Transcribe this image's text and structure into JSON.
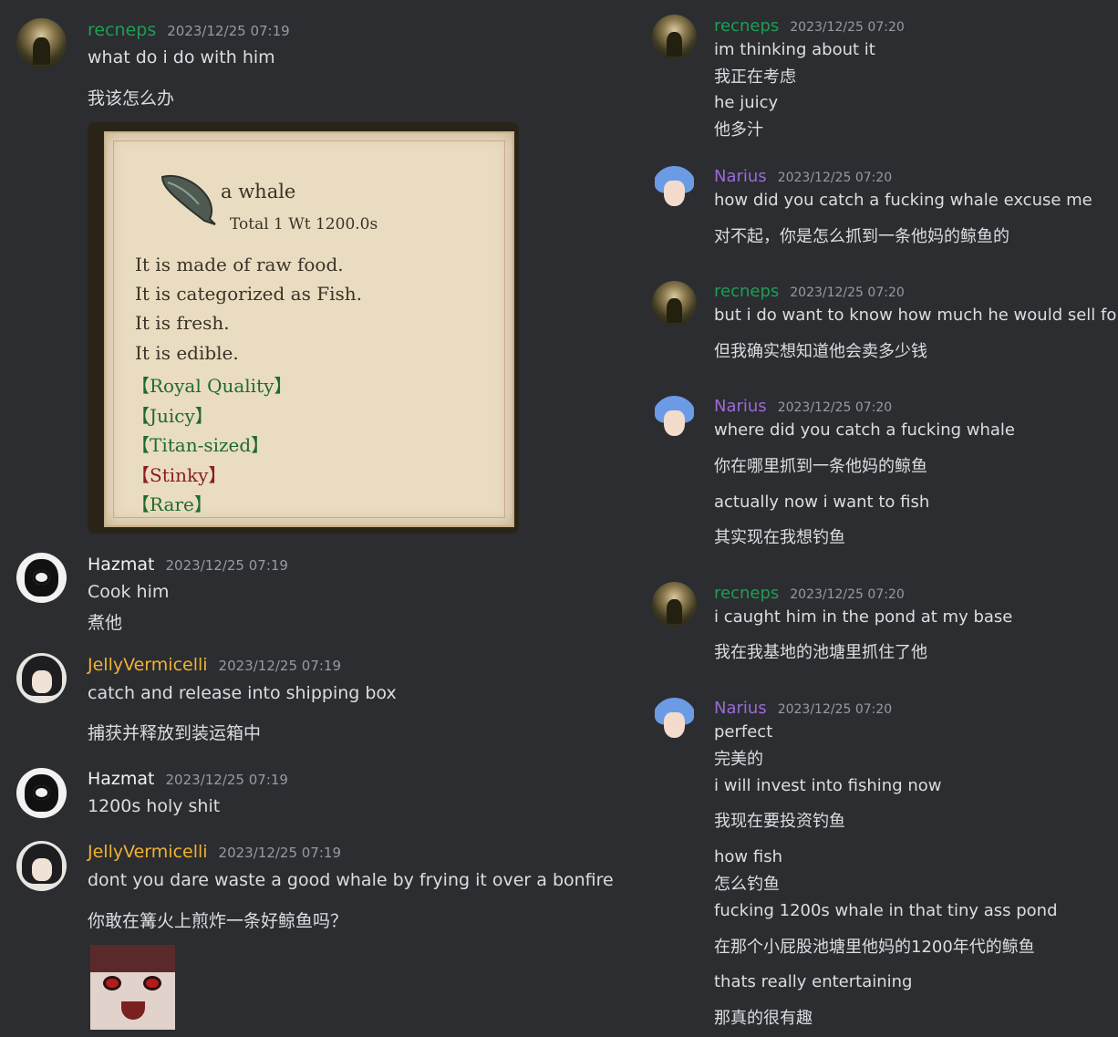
{
  "colors": {
    "background": "#2b2d31",
    "recneps": "#1f9d55",
    "hazmat": "#f2f3f5",
    "jelly": "#f0b232",
    "narius": "#9b6bd6",
    "timestamp": "#949ba4"
  },
  "left": {
    "m1": {
      "user": "recneps",
      "time": "2023/12/25 07:19",
      "lines": [
        "what do i do with him",
        "我该怎么办"
      ],
      "card": {
        "title": "a whale",
        "total": "Total 1  Wt 1200.0s",
        "desc": [
          "It is made of raw food.",
          "It is categorized as Fish.",
          "It is fresh.",
          "It is edible."
        ],
        "tags": [
          "【Royal Quality】",
          "【Juicy】",
          "【Titan-sized】",
          "【Stinky】",
          "【Rare】"
        ]
      }
    },
    "m2": {
      "user": "Hazmat",
      "time": "2023/12/25 07:19",
      "lines": [
        "Cook him",
        "煮他"
      ]
    },
    "m3": {
      "user": "JellyVermicelli",
      "time": "2023/12/25 07:19",
      "lines": [
        "catch and release into shipping box",
        "捕获并释放到装运箱中"
      ]
    },
    "m4": {
      "user": "Hazmat",
      "time": "2023/12/25 07:19",
      "lines": [
        "1200s holy shit"
      ]
    },
    "m5": {
      "user": "JellyVermicelli",
      "time": "2023/12/25 07:19",
      "lines": [
        "dont you dare waste a good whale by frying it over a bonfire",
        "你敢在篝火上煎炸一条好鲸鱼吗？"
      ]
    }
  },
  "right": {
    "m1": {
      "user": "recneps",
      "time": "2023/12/25 07:20",
      "lines": [
        "im thinking about it",
        "我正在考虑",
        "he juicy",
        "他多汁"
      ]
    },
    "m2": {
      "user": "Narius",
      "time": "2023/12/25 07:20",
      "lines": [
        "how did you catch a fucking whale excuse me",
        "对不起，你是怎么抓到一条他妈的鲸鱼的"
      ]
    },
    "m3": {
      "user": "recneps",
      "time": "2023/12/25 07:20",
      "lines": [
        "but i do want to know how much he would sell for",
        "但我确实想知道他会卖多少钱"
      ]
    },
    "m4": {
      "user": "Narius",
      "time": "2023/12/25 07:20",
      "lines": [
        "where did you catch a fucking whale",
        "你在哪里抓到一条他妈的鲸鱼",
        "actually now i want to fish",
        "其实现在我想钓鱼"
      ]
    },
    "m5": {
      "user": "recneps",
      "time": "2023/12/25 07:20",
      "lines": [
        "i caught him in the pond at my base",
        "我在我基地的池塘里抓住了他"
      ]
    },
    "m6": {
      "user": "Narius",
      "time": "2023/12/25 07:20",
      "lines": [
        "perfect",
        "完美的",
        "i will invest into fishing now",
        "我现在要投资钓鱼",
        "how fish",
        "怎么钓鱼",
        "fucking 1200s whale in that tiny ass pond",
        "在那个小屁股池塘里他妈的1200年代的鲸鱼",
        "thats really entertaining",
        "那真的很有趣"
      ]
    }
  }
}
